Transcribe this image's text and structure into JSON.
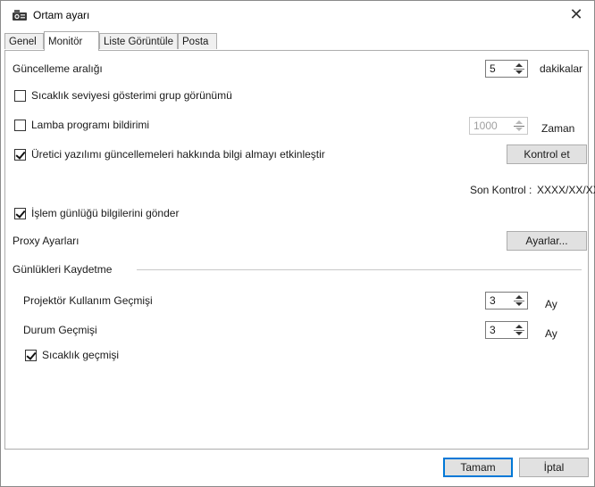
{
  "window": {
    "title": "Ortam ayarı",
    "close_symbol": "✕"
  },
  "tabs": [
    {
      "label": "Genel",
      "active": false
    },
    {
      "label": "Monitör",
      "active": true
    },
    {
      "label": "Liste Görüntüle",
      "active": false
    },
    {
      "label": "Posta",
      "active": false
    }
  ],
  "monitor": {
    "update_interval": {
      "label": "Güncelleme aralığı",
      "value": "5",
      "unit": "dakikalar"
    },
    "temp_group_view": {
      "label": "Sıcaklık seviyesi gösterimi grup görünümü",
      "checked": false
    },
    "lamp_program": {
      "label": "Lamba programı bildirimi",
      "checked": false,
      "value": "1000",
      "unit": "Zaman",
      "disabled": true
    },
    "firmware_updates": {
      "label": "Üretici yazılımı güncellemeleri hakkında bilgi almayı etkinleştir",
      "checked": true,
      "button": "Kontrol et"
    },
    "last_check": {
      "label": "Son Kontrol :",
      "value": "XXXX/XX/XX"
    },
    "send_log": {
      "label": "İşlem günlüğü bilgilerini gönder",
      "checked": true
    },
    "proxy": {
      "label": "Proxy Ayarları",
      "button": "Ayarlar..."
    },
    "save_logs": {
      "title": "Günlükleri Kaydetme",
      "usage_history": {
        "label": "Projektör Kullanım Geçmişi",
        "value": "3",
        "unit": "Ay"
      },
      "status_history": {
        "label": "Durum Geçmişi",
        "value": "3",
        "unit": "Ay"
      },
      "temp_history": {
        "label": "Sıcaklık geçmişi",
        "checked": true
      }
    }
  },
  "footer": {
    "ok": "Tamam",
    "cancel": "İptal"
  }
}
